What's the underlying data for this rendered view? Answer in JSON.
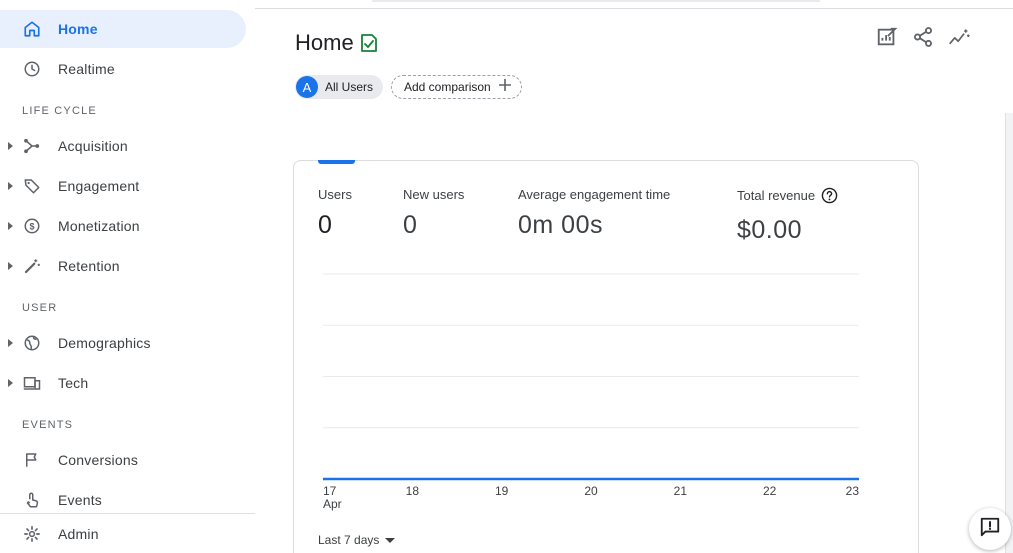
{
  "nav": {
    "home": "Home",
    "realtime": "Realtime",
    "section_lifecycle": "LIFE CYCLE",
    "acquisition": "Acquisition",
    "engagement": "Engagement",
    "monetization": "Monetization",
    "retention": "Retention",
    "section_user": "USER",
    "demographics": "Demographics",
    "tech": "Tech",
    "section_events": "EVENTS",
    "conversions": "Conversions",
    "events": "Events",
    "admin": "Admin"
  },
  "header": {
    "title": "Home"
  },
  "comparison": {
    "segment_avatar": "A",
    "segment_label": "All Users",
    "add_label": "Add comparison"
  },
  "metrics": [
    {
      "label": "Users",
      "value": "0"
    },
    {
      "label": "New users",
      "value": "0"
    },
    {
      "label": "Average engagement time",
      "value": "0m 00s"
    },
    {
      "label": "Total revenue",
      "value": "$0.00"
    }
  ],
  "chart_data": {
    "type": "line",
    "x": [
      "17",
      "18",
      "19",
      "20",
      "21",
      "22",
      "23"
    ],
    "x_sublabel_first": "Apr",
    "series": [
      {
        "values": [
          0,
          0,
          0,
          0,
          0,
          0,
          0
        ],
        "color": "#1a73e8"
      }
    ],
    "grid": true,
    "gridlines": 5
  },
  "date_range": {
    "label": "Last 7 days"
  },
  "colors": {
    "accent": "#1a73e8",
    "active_bg": "#e8f0fe",
    "check_green": "#188038"
  }
}
